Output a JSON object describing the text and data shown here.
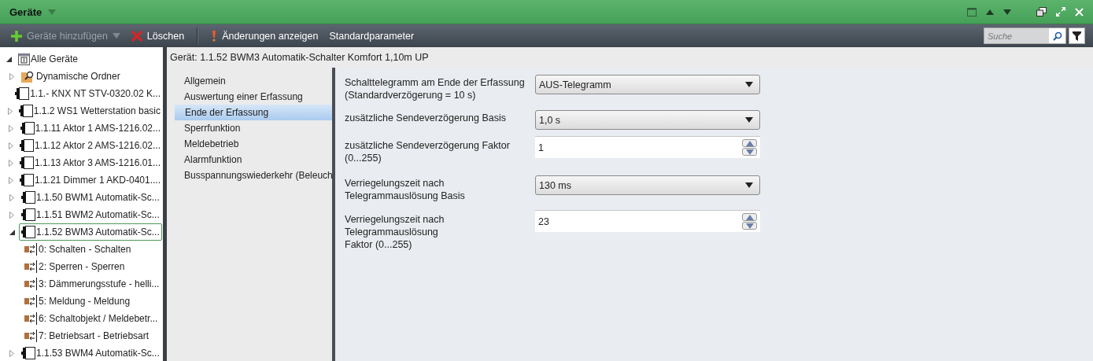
{
  "window": {
    "title": "Geräte"
  },
  "toolbar": {
    "items": [
      {
        "kind": "add",
        "label": "Geräte hinzufügen",
        "disabled": true
      },
      {
        "kind": "delete",
        "label": "Löschen",
        "disabled": false
      },
      {
        "kind": "changes",
        "label": "Änderungen anzeigen",
        "disabled": false
      },
      {
        "kind": "plain",
        "label": "Standardparameter",
        "disabled": false
      }
    ],
    "search": {
      "placeholder": "Suche"
    }
  },
  "tree": {
    "items": [
      {
        "kind": "root",
        "label": "Alle Geräte",
        "expanded": true,
        "selected": false,
        "children": [
          {
            "kind": "folder",
            "label": "Dynamische Ordner",
            "expanded": false,
            "selected": false
          },
          {
            "kind": "device",
            "label": "1.1.- KNX NT STV-0320.02 K...",
            "selected": false
          },
          {
            "kind": "device",
            "label": "1.1.2 WS1 Wetterstation basic",
            "expanded": false,
            "selected": false
          },
          {
            "kind": "device",
            "label": "1.1.11 Aktor 1 AMS-1216.02...",
            "expanded": false,
            "selected": false
          },
          {
            "kind": "device",
            "label": "1.1.12 Aktor 2 AMS-1216.02...",
            "expanded": false,
            "selected": false
          },
          {
            "kind": "device",
            "label": "1.1.13 Aktor 3 AMS-1216.01...",
            "expanded": false,
            "selected": false
          },
          {
            "kind": "device",
            "label": "1.1.21 Dimmer 1 AKD-0401....",
            "expanded": false,
            "selected": false
          },
          {
            "kind": "device",
            "label": "1.1.50 BWM1 Automatik-Sc...",
            "expanded": false,
            "selected": false
          },
          {
            "kind": "device",
            "label": "1.1.51 BWM2 Automatik-Sc...",
            "expanded": false,
            "selected": false
          },
          {
            "kind": "device",
            "label": "1.1.52 BWM3 Automatik-Sc...",
            "expanded": true,
            "selected": true,
            "children": [
              {
                "kind": "object",
                "label": "0: Schalten - Schalten",
                "selected": false
              },
              {
                "kind": "object",
                "label": "2: Sperren - Sperren",
                "selected": false
              },
              {
                "kind": "object",
                "label": "3: Dämmerungsstufe - helli...",
                "selected": false
              },
              {
                "kind": "object",
                "label": "5: Meldung - Meldung",
                "selected": false
              },
              {
                "kind": "object",
                "label": "6: Schaltobjekt / Meldebetr...",
                "selected": false
              },
              {
                "kind": "object",
                "label": "7: Betriebsart - Betriebsart",
                "selected": false
              }
            ]
          },
          {
            "kind": "device",
            "label": "1.1.53 BWM4 Automatik-Sc...",
            "expanded": false,
            "selected": false
          }
        ]
      }
    ]
  },
  "detail": {
    "title": "Gerät: 1.1.52 BWM3 Automatik-Schalter Komfort 1,10m UP",
    "nav": [
      {
        "label": "Allgemein",
        "selected": false
      },
      {
        "label": "Auswertung einer Erfassung",
        "selected": false
      },
      {
        "label": "Ende der Erfassung",
        "selected": true
      },
      {
        "label": "Sperrfunktion",
        "selected": false
      },
      {
        "label": "Meldebetrieb",
        "selected": false
      },
      {
        "label": "Alarmfunktion",
        "selected": false
      },
      {
        "label": "Busspannungswiederkehr (Beleuch",
        "selected": false
      }
    ],
    "params": [
      {
        "kind": "dropdown",
        "label": [
          "Schalttelegramm am Ende der Erfassung",
          "(Standardverzögerung = 10 s)"
        ],
        "value": "AUS-Telegramm"
      },
      {
        "kind": "dropdown",
        "label": [
          "zusätzliche Sendeverzögerung Basis"
        ],
        "value": "1,0 s"
      },
      {
        "kind": "spin",
        "label": [
          "zusätzliche Sendeverzögerung Faktor",
          "(0...255)"
        ],
        "value": "1"
      },
      {
        "kind": "dropdown",
        "label": [
          "Verriegelungszeit nach",
          "Telegrammauslösung Basis"
        ],
        "value": "130 ms"
      },
      {
        "kind": "spin",
        "label": [
          "Verriegelungszeit nach",
          "Telegrammauslösung",
          "Faktor (0...255)"
        ],
        "value": "23"
      }
    ]
  }
}
